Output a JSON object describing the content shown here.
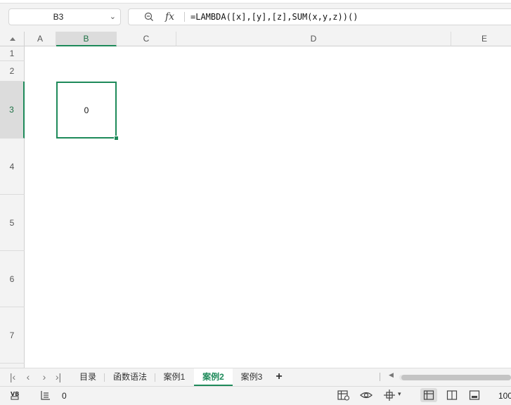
{
  "formula_bar": {
    "name_box": "B3",
    "fx_label": "fx",
    "formula": "=LAMBDA([x],[y],[z],SUM(x,y,z))()"
  },
  "grid": {
    "columns": [
      "A",
      "B",
      "C",
      "D",
      "E"
    ],
    "rows": [
      "1",
      "2",
      "3",
      "4",
      "5",
      "6",
      "7"
    ],
    "selected_column": "B",
    "selected_row": "3",
    "cells": {
      "B3": "0"
    },
    "accent_color": "#1e8a5a"
  },
  "sheet_tabs": {
    "tabs": [
      "目录",
      "函数语法",
      "案例1",
      "案例2",
      "案例3"
    ],
    "active": "案例2",
    "add_label": "+"
  },
  "status_bar": {
    "count": "0",
    "zoom": "100"
  }
}
